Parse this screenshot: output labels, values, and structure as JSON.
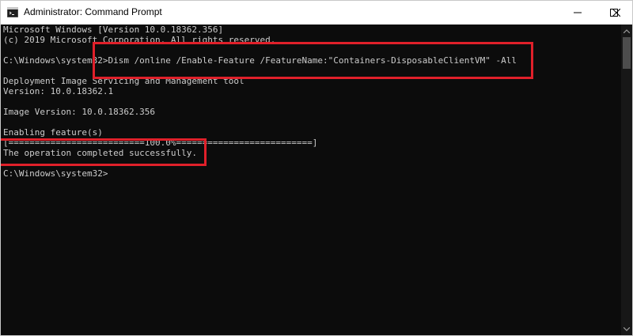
{
  "window": {
    "title": "Administrator: Command Prompt",
    "icon": "cmd-icon",
    "controls": {
      "minimize_icon": "minimize-icon",
      "maximize_icon": "maximize-icon",
      "close_icon": "close-icon"
    }
  },
  "console": {
    "lines": [
      "Microsoft Windows [Version 10.0.18362.356]",
      "(c) 2019 Microsoft Corporation. All rights reserved.",
      "",
      "C:\\Windows\\system32>Dism /online /Enable-Feature /FeatureName:\"Containers-DisposableClientVM\" -All",
      "",
      "Deployment Image Servicing and Management tool",
      "Version: 10.0.18362.1",
      "",
      "Image Version: 10.0.18362.356",
      "",
      "Enabling feature(s)",
      "[==========================100.0%==========================]",
      "The operation completed successfully.",
      "",
      "C:\\Windows\\system32>"
    ],
    "progress_percent": 100.0
  },
  "annotations": {
    "highlight_color": "#e0202a",
    "highlighted_items": [
      "command-line",
      "success-message"
    ]
  },
  "colors": {
    "console_bg": "#0c0c0c",
    "console_text": "#cccccc",
    "titlebar_bg": "#ffffff"
  }
}
